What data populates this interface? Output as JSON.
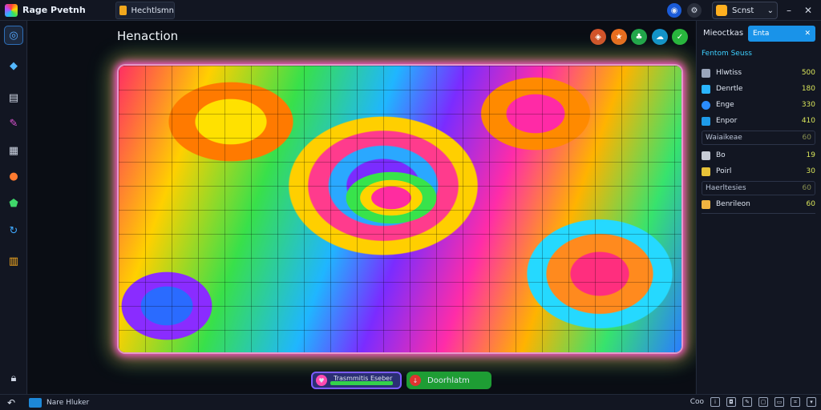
{
  "app": {
    "name": "Rage Pvetnh"
  },
  "tab": {
    "label": "Hechtlsmn"
  },
  "profile": {
    "label": "Scnst"
  },
  "canvas": {
    "title": "Henaction"
  },
  "right_panel": {
    "header": "Mieoctkas",
    "search_value": "Enta",
    "section_title": "Fentom Seuss",
    "rows": [
      {
        "label": "Hlwtiss",
        "value": "500",
        "icon_color": "#9aa6bc"
      },
      {
        "label": "Denrtle",
        "value": "180",
        "icon_color": "#2ab5ff"
      },
      {
        "label": "Enge",
        "value": "330",
        "icon_color": "#2a8cff"
      },
      {
        "label": "Enpor",
        "value": "410",
        "icon_color": "#1e9be9"
      }
    ],
    "group1": {
      "label": "Waiaikeae",
      "value": "60"
    },
    "rows2": [
      {
        "label": "Bo",
        "value": "19",
        "icon_color": "#c7ccd6"
      },
      {
        "label": "Poirl",
        "value": "30",
        "icon_color": "#e7c238"
      }
    ],
    "group2": {
      "label": "Haerltesies",
      "value": "60"
    },
    "row3": {
      "label": "Benrileon",
      "value": "60",
      "icon_color": "#f0b341"
    }
  },
  "actions": {
    "left_label": "Trasmmitis Eseber",
    "left_progress": 0.9,
    "right_label": "Doorhlatm"
  },
  "status": {
    "label": "Nare Hluker",
    "zoom": "Coo"
  },
  "colors": {
    "accent": "#1993e9",
    "value_text": "#d8e45a",
    "section": "#3dd0ff"
  }
}
